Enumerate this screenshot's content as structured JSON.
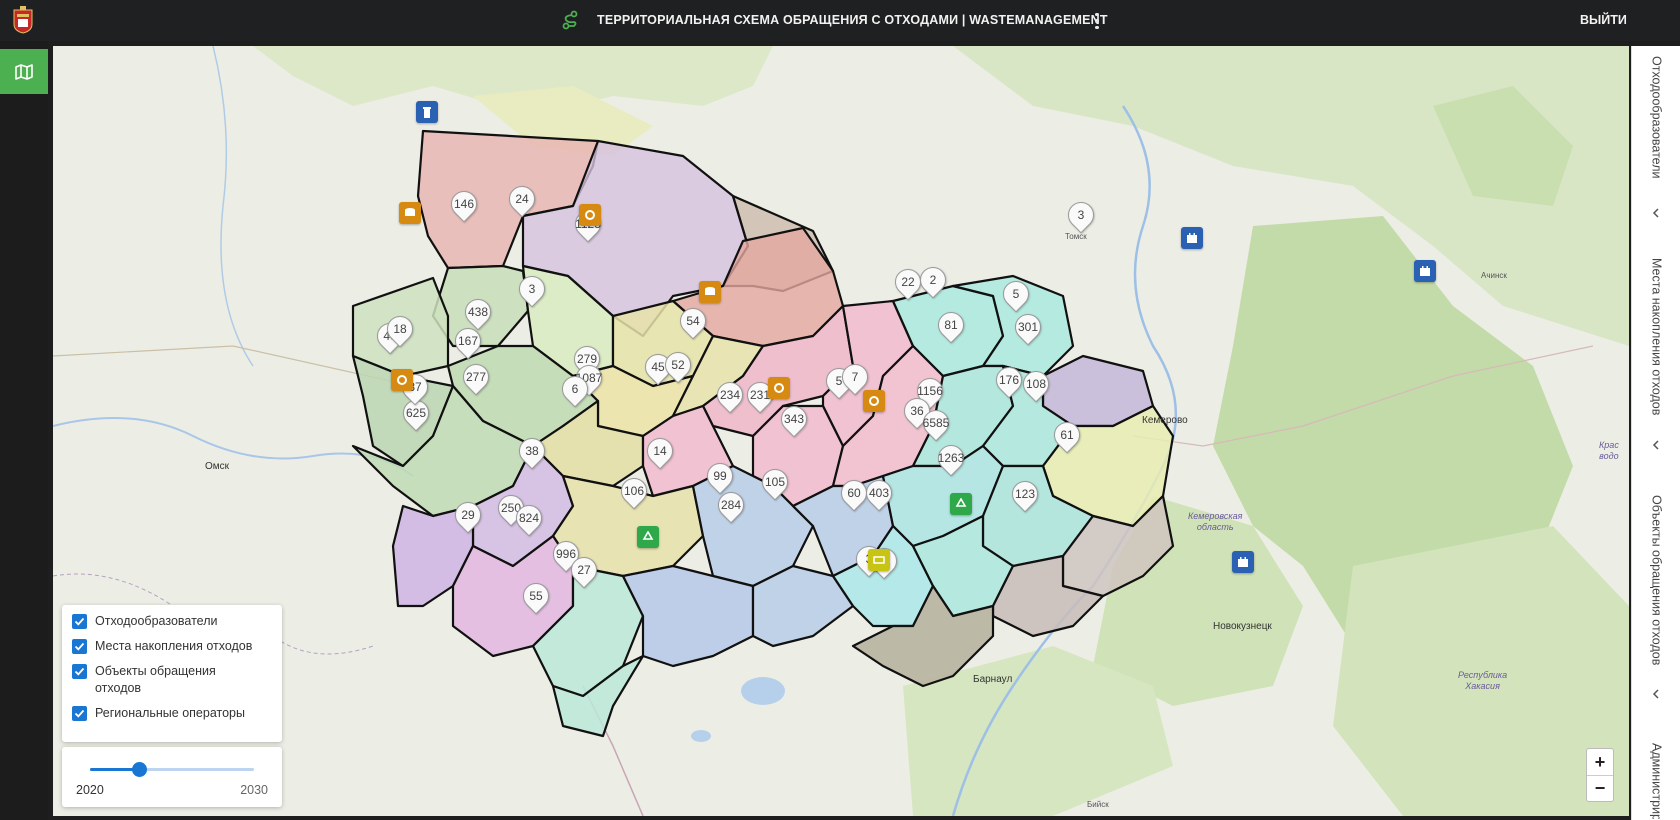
{
  "header": {
    "title": "ТЕРРИТОРИАЛЬНАЯ СХЕМА ОБРАЩЕНИЯ С ОТХОДАМИ | WASTEMANAGEMENT",
    "logout": "ВЫЙТИ"
  },
  "map": {
    "places": {
      "omsk": "Омск",
      "tomsk": "Томск",
      "kemerovo": "Кемерово",
      "achinsk": "Ачинск",
      "novokuznetsk": "Новокузнецк",
      "barnaul": "Барнаул",
      "biysk": "Бийск",
      "kemerovo_oblast": "Кемеровская\nобласть",
      "khakassia": "Республика\nХакасия",
      "krasnoyarsk_water": "Крас\nводо"
    },
    "pins": [
      "146",
      "24",
      "1128",
      "3",
      "438",
      "167",
      "40",
      "18",
      "277",
      "625",
      "87",
      "279",
      "1087",
      "6",
      "45",
      "52",
      "54",
      "234",
      "231",
      "343",
      "5",
      "7",
      "22",
      "2",
      "81",
      "1156",
      "36",
      "6585",
      "5",
      "301",
      "176",
      "108",
      "61",
      "1263",
      "38",
      "14",
      "106",
      "99",
      "284",
      "105",
      "60",
      "403",
      "250",
      "824",
      "29",
      "996",
      "27",
      "55",
      "123",
      "3",
      "32",
      "3"
    ]
  },
  "layers": {
    "items": [
      {
        "label": "Отходообразователи",
        "checked": true
      },
      {
        "label": "Места накопления отходов",
        "checked": true
      },
      {
        "label": "Объекты обращения отходов",
        "checked": true
      },
      {
        "label": "Региональные операторы",
        "checked": true
      }
    ]
  },
  "year_slider": {
    "min": "2020",
    "max": "2030",
    "value_fraction": 0.3
  },
  "zoom": {
    "plus": "+",
    "minus": "−"
  },
  "right_panel": {
    "tabs": [
      {
        "label": "Отходообразователи"
      },
      {
        "label": "Места накопления отходов"
      },
      {
        "label": "Объекты обращения отходов"
      },
      {
        "label": "Администрирование"
      }
    ]
  },
  "colors": {
    "accent_green": "#4caf50",
    "checkbox_blue": "#1976d2",
    "topbar": "#1f2021"
  }
}
